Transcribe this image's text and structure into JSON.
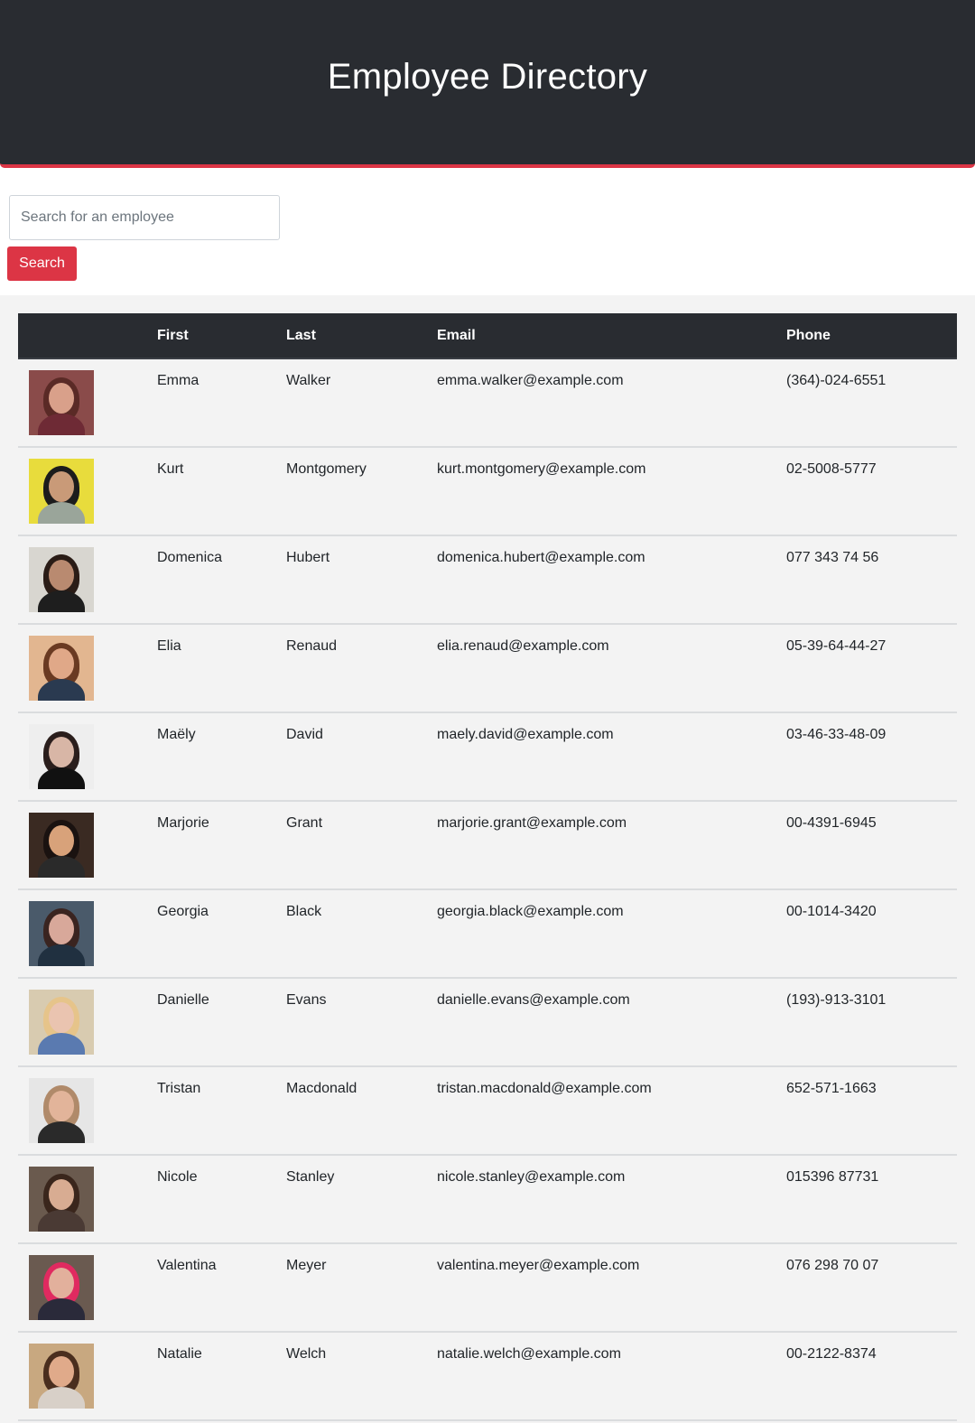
{
  "header": {
    "title": "Employee Directory"
  },
  "search": {
    "placeholder": "Search for an employee",
    "button_label": "Search"
  },
  "colors": {
    "header_bg": "#292c31",
    "accent": "#dc3545",
    "table_bg": "#f3f3f3"
  },
  "table": {
    "columns": [
      "",
      "First",
      "Last",
      "Email",
      "Phone"
    ],
    "rows": [
      {
        "first": "Emma",
        "last": "Walker",
        "email": "emma.walker@example.com",
        "phone": "(364)-024-6551",
        "avatar": {
          "bg": "#8a4b4a",
          "skin": "#d9a08a",
          "hair": "#5a2a26",
          "shirt": "#6e2a35"
        }
      },
      {
        "first": "Kurt",
        "last": "Montgomery",
        "email": "kurt.montgomery@example.com",
        "phone": "02-5008-5777",
        "avatar": {
          "bg": "#e8dc3c",
          "skin": "#c99a78",
          "hair": "#1c1c1c",
          "shirt": "#9aa59a"
        }
      },
      {
        "first": "Domenica",
        "last": "Hubert",
        "email": "domenica.hubert@example.com",
        "phone": "077 343 74 56",
        "avatar": {
          "bg": "#d8d6d0",
          "skin": "#b98a70",
          "hair": "#2a1c16",
          "shirt": "#1e1e1e"
        }
      },
      {
        "first": "Elia",
        "last": "Renaud",
        "email": "elia.renaud@example.com",
        "phone": "05-39-64-44-27",
        "avatar": {
          "bg": "#e2b690",
          "skin": "#e0a888",
          "hair": "#6a3a22",
          "shirt": "#2a3a50"
        }
      },
      {
        "first": "Maëly",
        "last": "David",
        "email": "maely.david@example.com",
        "phone": "03-46-33-48-09",
        "avatar": {
          "bg": "#eeeeee",
          "skin": "#d8b6a6",
          "hair": "#2a1e1c",
          "shirt": "#111111"
        }
      },
      {
        "first": "Marjorie",
        "last": "Grant",
        "email": "marjorie.grant@example.com",
        "phone": "00-4391-6945",
        "avatar": {
          "bg": "#3a2a22",
          "skin": "#d8a27a",
          "hair": "#1a1210",
          "shirt": "#2a2a2a"
        }
      },
      {
        "first": "Georgia",
        "last": "Black",
        "email": "georgia.black@example.com",
        "phone": "00-1014-3420",
        "avatar": {
          "bg": "#4a5a6a",
          "skin": "#d8a89a",
          "hair": "#3a2420",
          "shirt": "#203040"
        }
      },
      {
        "first": "Danielle",
        "last": "Evans",
        "email": "danielle.evans@example.com",
        "phone": "(193)-913-3101",
        "avatar": {
          "bg": "#d8cbb0",
          "skin": "#eac4b0",
          "hair": "#e6c48a",
          "shirt": "#5a7ab0"
        }
      },
      {
        "first": "Tristan",
        "last": "Macdonald",
        "email": "tristan.macdonald@example.com",
        "phone": "652-571-1663",
        "avatar": {
          "bg": "#e6e6e6",
          "skin": "#e2b49a",
          "hair": "#b08a6a",
          "shirt": "#2a2a2a"
        }
      },
      {
        "first": "Nicole",
        "last": "Stanley",
        "email": "nicole.stanley@example.com",
        "phone": "015396 87731",
        "avatar": {
          "bg": "#6a5a4e",
          "skin": "#d8ac92",
          "hair": "#3a261c",
          "shirt": "#4a3a34"
        }
      },
      {
        "first": "Valentina",
        "last": "Meyer",
        "email": "valentina.meyer@example.com",
        "phone": "076 298 70 07",
        "avatar": {
          "bg": "#6a5a50",
          "skin": "#e2b09c",
          "hair": "#e02a60",
          "shirt": "#2a2a3a"
        }
      },
      {
        "first": "Natalie",
        "last": "Welch",
        "email": "natalie.welch@example.com",
        "phone": "00-2122-8374",
        "avatar": {
          "bg": "#c8a880",
          "skin": "#e0aa8a",
          "hair": "#4a2e1e",
          "shirt": "#d8d0c8"
        }
      }
    ]
  }
}
